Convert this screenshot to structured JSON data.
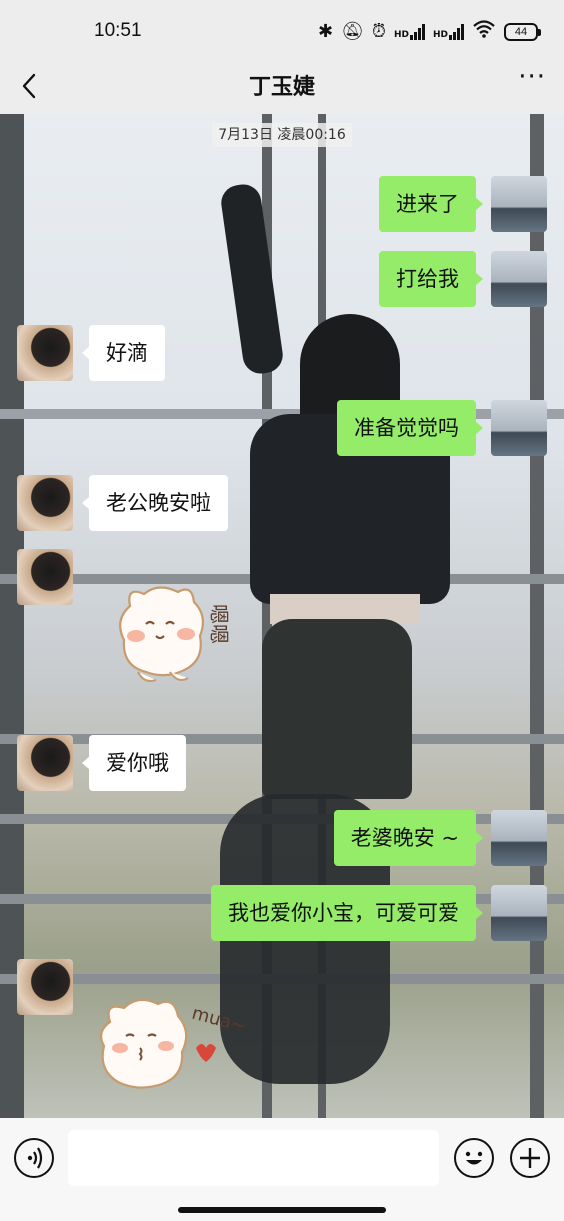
{
  "status_bar": {
    "time": "10:51",
    "battery": "44"
  },
  "header": {
    "title": "丁玉婕",
    "more": "···"
  },
  "chat": {
    "timestamp": "7月13日 凌晨00:16",
    "messages": [
      {
        "side": "right",
        "text": "进来了"
      },
      {
        "side": "right",
        "text": "打给我"
      },
      {
        "side": "left",
        "text": "好滴"
      },
      {
        "side": "right",
        "text": "准备觉觉吗"
      },
      {
        "side": "left",
        "text": "老公晚安啦"
      },
      {
        "side": "left",
        "type": "sticker",
        "sticker": "嗯嗯"
      },
      {
        "side": "left",
        "text": "爱你哦"
      },
      {
        "side": "right",
        "text": "老婆晚安 ~"
      },
      {
        "side": "right",
        "text": "我也爱你小宝，可爱可爱"
      },
      {
        "side": "left",
        "type": "sticker",
        "sticker": "mua~"
      }
    ]
  },
  "input_bar": {
    "placeholder": ""
  },
  "colors": {
    "sent_bubble": "#95ec69",
    "received_bubble": "#ffffff",
    "background": "#ededed"
  },
  "icons": [
    "back-arrow-icon",
    "more-icon",
    "voice-icon",
    "emoji-icon",
    "plus-icon",
    "bluetooth-icon",
    "mute-icon",
    "alarm-icon",
    "signal-icon",
    "wifi-icon",
    "battery-icon"
  ]
}
